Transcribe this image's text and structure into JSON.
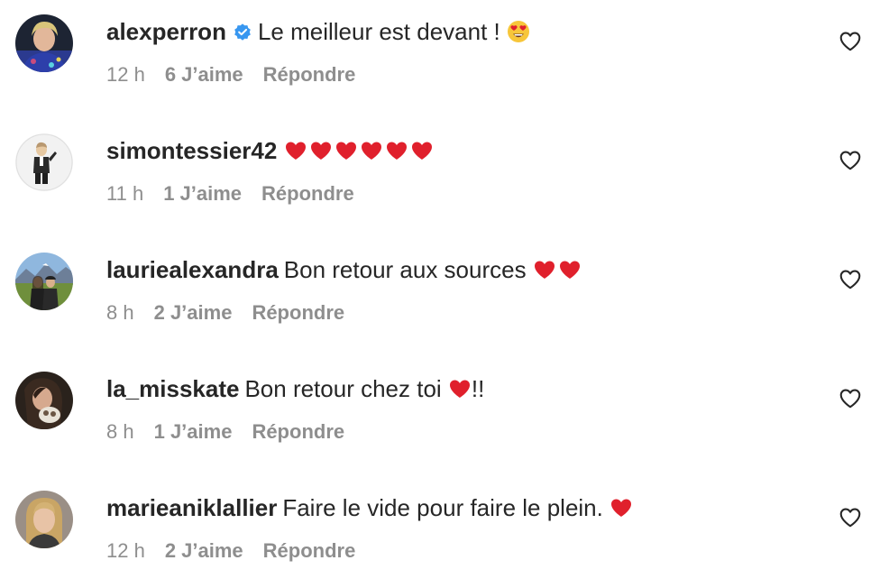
{
  "comments": [
    {
      "username": "alexperron",
      "verified": true,
      "text": "Le meilleur est devant !",
      "emoji": "heart-eyes",
      "time": "12 h",
      "likes": "6 J’aime",
      "reply": "Répondre"
    },
    {
      "username": "simontessier42",
      "verified": false,
      "text": "",
      "emoji": "red-hearts-x6",
      "time": "11 h",
      "likes": "1 J’aime",
      "reply": "Répondre"
    },
    {
      "username": "lauriealexandra",
      "verified": false,
      "text": "Bon retour aux sources",
      "emoji": "red-hearts-x2",
      "time": "8 h",
      "likes": "2 J’aime",
      "reply": "Répondre"
    },
    {
      "username": "la_misskate",
      "verified": false,
      "text": "Bon retour chez toi",
      "emoji": "red-heart",
      "text_after": "!!",
      "time": "8 h",
      "likes": "1 J’aime",
      "reply": "Répondre"
    },
    {
      "username": "marieaniklallier",
      "verified": false,
      "text": "Faire le vide pour faire le plein.",
      "emoji": "red-heart",
      "time": "12 h",
      "likes": "2 J’aime",
      "reply": "Répondre"
    }
  ],
  "colors": {
    "text": "#262626",
    "secondary": "#8e8e8e",
    "verified": "#3897f0",
    "heart_red": "#e0202c",
    "emoji_yellow": "#f7c63a"
  },
  "icons": {
    "like": "heart-outline-icon",
    "verified": "verified-badge-icon"
  }
}
